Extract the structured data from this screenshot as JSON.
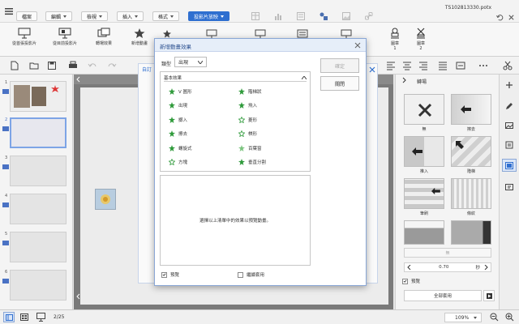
{
  "menubar": {
    "menus": [
      "檔案",
      "編輯",
      "檢視",
      "插入",
      "格式",
      "投影片放映"
    ],
    "filename": "TS102813330.potx"
  },
  "ribbon": {
    "buttons": [
      "從首張投影片",
      "從目前投影片",
      "轉場效果",
      "新增動畫",
      "圖章\n1",
      "圖章\n2"
    ]
  },
  "thumbnails": {
    "numbers": [
      "1",
      "2",
      "3",
      "4",
      "5",
      "6"
    ]
  },
  "dialog": {
    "title": "新增動畫效果",
    "type_label": "類型",
    "type_value": "出現",
    "confirm": "確定",
    "close": "關閉",
    "section": "基本效果",
    "effects_left": [
      "V 圖形",
      "出現",
      "擲入",
      "擦去",
      "螺旋式",
      "方塊"
    ],
    "effects_right": [
      "階梯狀",
      "飛入",
      "菱形",
      "棋形",
      "百葉窗",
      "垂直分割"
    ],
    "preview_hint": "選擇以上清單中的效果以預覽動畫。",
    "preview_check": "預覽",
    "continue_check": "繼續套用"
  },
  "bg_panel": {
    "label": "自訂"
  },
  "transition_pane": {
    "title": "轉場",
    "tiles": [
      "無",
      "擦去",
      "推入",
      "階梯",
      "筆刷",
      "條紋",
      "",
      ""
    ],
    "direction": "無",
    "duration": "0.70",
    "unit": "秒",
    "preview": "預覽",
    "apply_all": "全部套用"
  },
  "status": {
    "page": "2/25",
    "zoom": "109%"
  },
  "colors": {
    "accent": "#2f6fd0",
    "star": "#2e9a3a"
  }
}
